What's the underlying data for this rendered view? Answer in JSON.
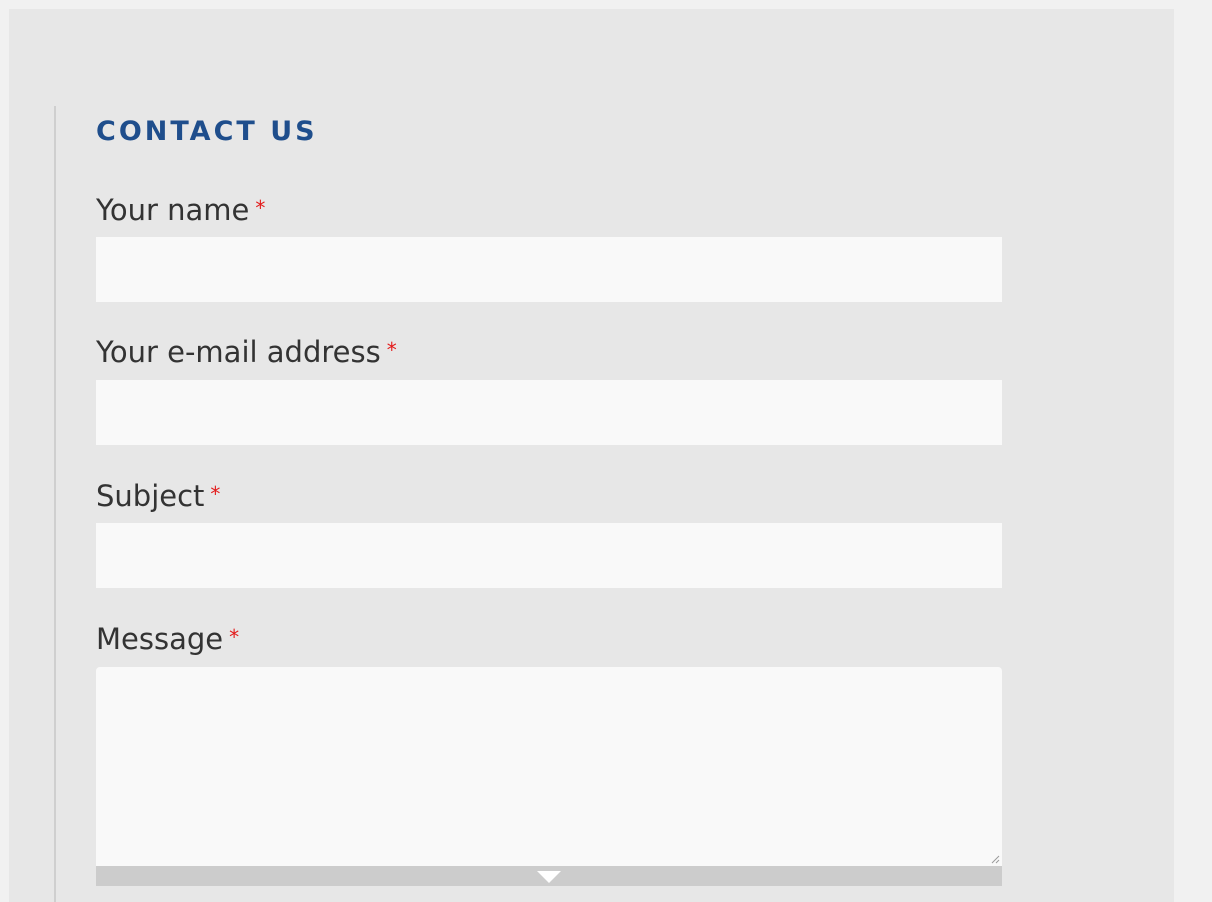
{
  "contact_block": {
    "title": "CONTACT US",
    "required_marker": "*",
    "fields": {
      "name": {
        "label": "Your name",
        "value": ""
      },
      "email": {
        "label": "Your e-mail address",
        "value": ""
      },
      "subject": {
        "label": "Subject",
        "value": ""
      },
      "message": {
        "label": "Message",
        "value": ""
      }
    }
  },
  "colors": {
    "title": "#1f4e8c",
    "required": "#e31b1b",
    "panel_background": "#e7e7e7",
    "input_background": "#f9f9f9",
    "grippie": "#cccccc"
  },
  "icons": {
    "grippie": "triangle-down-icon",
    "resize": "resize-handle-icon"
  }
}
